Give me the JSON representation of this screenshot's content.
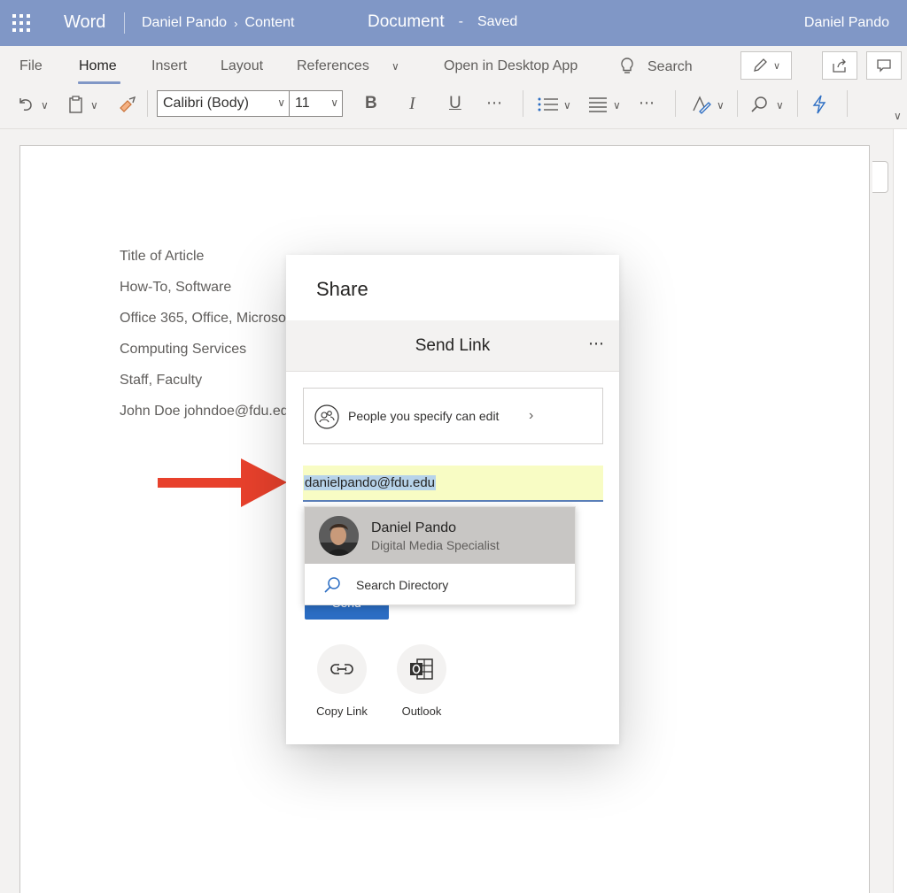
{
  "titlebar": {
    "app_name": "Word",
    "breadcrumb_user": "Daniel Pando",
    "breadcrumb_folder": "Content",
    "document_name": "Document",
    "separator": "-",
    "save_status": "Saved",
    "user_name": "Daniel Pando"
  },
  "ribbon": {
    "tabs": [
      "File",
      "Home",
      "Insert",
      "Layout",
      "References"
    ],
    "active_tab": "Home",
    "open_desktop": "Open in Desktop App",
    "search_label": "Search",
    "font_name": "Calibri (Body)",
    "font_size": "11",
    "bold": "B",
    "italic": "I",
    "underline": "U",
    "more": "⋯"
  },
  "document": {
    "lines": [
      "Title of Article",
      "How-To, Software",
      "Office 365, Office, Microsoft",
      "Computing Services",
      "Staff, Faculty",
      "John Doe johndoe@fdu.edu"
    ]
  },
  "share_dialog": {
    "title": "Share",
    "subtitle": "Send Link",
    "more": "⋯",
    "permission": "People you specify can edit",
    "email_value": "danielpando@fdu.edu",
    "send_label": "Send",
    "actions": {
      "copy_link": "Copy Link",
      "outlook": "Outlook"
    }
  },
  "suggestions": {
    "person_name": "Daniel Pando",
    "person_title": "Digital Media Specialist",
    "search_directory": "Search Directory"
  },
  "colors": {
    "titlebar": "#8097c6",
    "arrow": "#e8412c",
    "send_button": "#2b6dc3",
    "email_highlight": "#f8fcc4"
  }
}
